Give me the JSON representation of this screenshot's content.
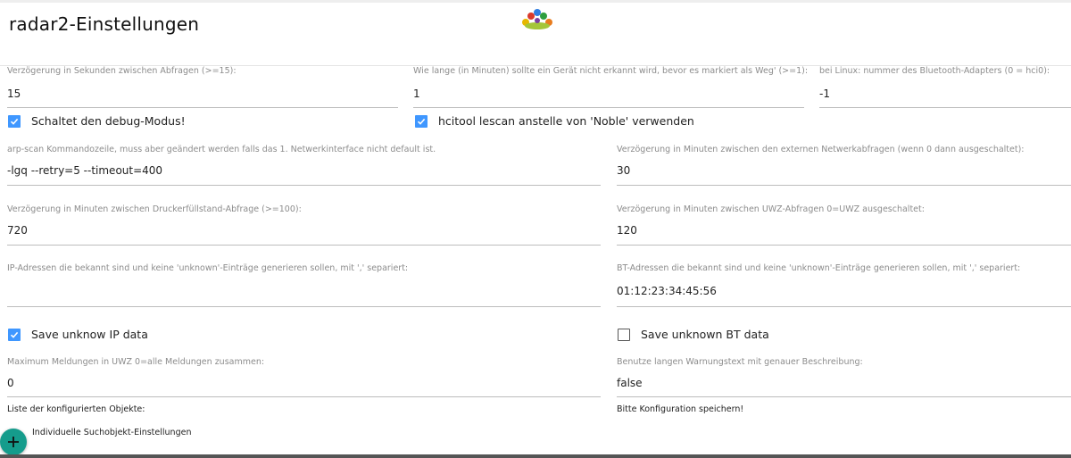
{
  "title": "radar2-Einstellungen",
  "fields": {
    "scan_delay": {
      "label": "Verzögerung in Sekunden zwischen Abfragen (>=15):",
      "value": "15"
    },
    "away_delay": {
      "label": "Wie lange (in Minuten) sollte ein Gerät nicht erkannt wird, bevor es markiert als Weg' (>=1):",
      "value": "1"
    },
    "bt_adapter": {
      "label": "bei Linux: nummer des Bluetooth-Adapters (0 = hci0):",
      "value": "-1"
    },
    "arp_scan": {
      "label": "arp-scan Kommandozeile, muss aber geändert werden falls das 1. Netwerkinterface nicht default ist.",
      "value": "-lgq --retry=5 --timeout=400"
    },
    "external_delay": {
      "label": "Verzögerung in Minuten zwischen den externen Netwerkabfragen (wenn 0 dann ausgeschaltet):",
      "value": "30"
    },
    "printer_delay": {
      "label": "Verzögerung in Minuten zwischen Druckerfüllstand-Abfrage (>=100):",
      "value": "720"
    },
    "uwz_delay": {
      "label": "Verzögerung in Minuten zwischen UWZ-Abfragen 0=UWZ ausgeschaltet:",
      "value": "120"
    },
    "known_ips": {
      "label": "IP-Adressen die bekannt sind und keine 'unknown'-Einträge generieren sollen, mit ',' separiert:",
      "value": ""
    },
    "known_bts": {
      "label": "BT-Adressen die bekannt sind und keine 'unknown'-Einträge generieren sollen, mit ',' separiert:",
      "value": "01:12:23:34:45:56"
    },
    "uwz_max": {
      "label": "Maximum Meldungen in UWZ 0=alle Meldungen zusammen:",
      "value": "0"
    },
    "long_warning": {
      "label": "Benutze langen Warnungstext mit genauer Beschreibung:",
      "value": "false"
    }
  },
  "checkboxes": {
    "debug": {
      "label": "Schaltet den debug-Modus!",
      "checked": true
    },
    "hcitool": {
      "label": "hcitool lescan anstelle von 'Noble' verwenden",
      "checked": true
    },
    "save_ip": {
      "label": "Save unknow IP data",
      "checked": true
    },
    "save_bt": {
      "label": "Save unknown BT data",
      "checked": false
    }
  },
  "notes": {
    "objects_list": "Liste der konfigurierten Objekte:",
    "save_config": "Bitte Konfiguration speichern!"
  },
  "add_button": {
    "label": "Individuelle Suchobjekt-Einstellungen",
    "icon": "plus-icon"
  },
  "colors": {
    "checkbox_accent": "#3f97ff",
    "fab": "#159c8c"
  }
}
